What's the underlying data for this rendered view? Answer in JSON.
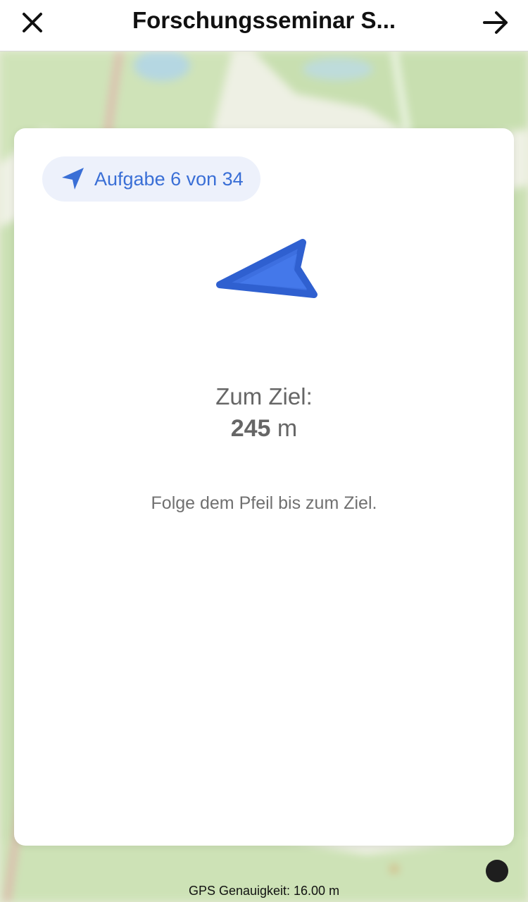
{
  "header": {
    "title": "Forschungsseminar S...",
    "close_icon": "close-icon",
    "next_icon": "arrow-right-icon"
  },
  "task": {
    "label": "Aufgabe 6 von 34",
    "icon": "navigation-arrow-icon"
  },
  "compass": {
    "icon": "direction-arrow-icon",
    "color": "#3d6fe0"
  },
  "distance": {
    "label": "Zum Ziel:",
    "value": "245",
    "unit": "m"
  },
  "hint": "Folge dem Pfeil bis zum Ziel.",
  "status": {
    "gps_accuracy": "GPS Genauigkeit: 16.00 m"
  },
  "colors": {
    "accent": "#3a6fd6",
    "pill_bg": "#edf1fb",
    "map_green": "#c9dfb2",
    "map_light": "#eef0e4"
  }
}
